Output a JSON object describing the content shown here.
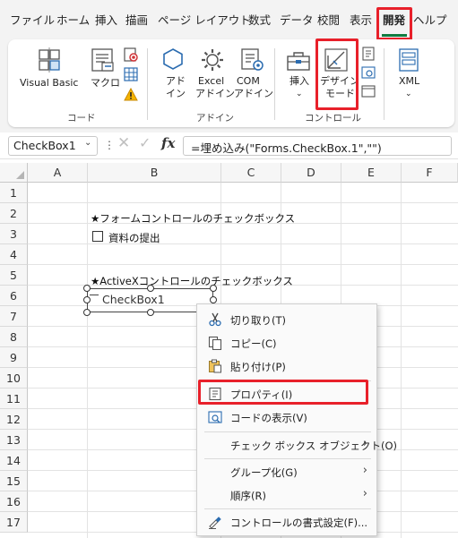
{
  "tabs": [
    {
      "label": "ファイル"
    },
    {
      "label": "ホーム"
    },
    {
      "label": "挿入"
    },
    {
      "label": "描画"
    },
    {
      "label": "ページ レイアウト"
    },
    {
      "label": "数式"
    },
    {
      "label": "データ"
    },
    {
      "label": "校閲"
    },
    {
      "label": "表示"
    },
    {
      "label": "開発"
    },
    {
      "label": "ヘルプ"
    }
  ],
  "ribbon": {
    "code_group": {
      "label": "コード",
      "visual_basic": "Visual Basic",
      "macro": "マクロ"
    },
    "addin_group": {
      "label": "アドイン",
      "addin_line1": "アド",
      "addin_line2": "イン",
      "excel_addin_line1": "Excel",
      "excel_addin_line2": "アドイン",
      "com_addin_line1": "COM",
      "com_addin_line2": "アドイン"
    },
    "controls_group": {
      "label": "コントロール",
      "insert": "挿入",
      "design_mode_line1": "デザイン",
      "design_mode_line2": "モード"
    },
    "xml": "XML"
  },
  "formula_bar": {
    "name_box": "CheckBox1",
    "formula": "=埋め込み(\"Forms.CheckBox.1\",\"\")"
  },
  "sheet": {
    "columns": [
      "A",
      "B",
      "C",
      "D",
      "E",
      "F"
    ],
    "rows": [
      "1",
      "2",
      "3",
      "4",
      "5",
      "6",
      "7",
      "8",
      "9",
      "10",
      "11",
      "12",
      "13",
      "14",
      "15",
      "16",
      "17"
    ],
    "b2": "★フォームコントロールのチェックボックス",
    "b3_checkbox_label": "資料の提出",
    "b5": "★ActiveXコントロールのチェックボックス",
    "activex_caption": "CheckBox1"
  },
  "context_menu": {
    "items": [
      {
        "label": "切り取り(T)"
      },
      {
        "label": "コピー(C)"
      },
      {
        "label": "貼り付け(P)"
      },
      {
        "label": "プロパティ(I)"
      },
      {
        "label": "コードの表示(V)"
      },
      {
        "label": "チェック ボックス オブジェクト(O)"
      },
      {
        "label": "グループ化(G)"
      },
      {
        "label": "順序(R)"
      },
      {
        "label": "コントロールの書式設定(F)..."
      }
    ]
  },
  "colors": {
    "highlight": "#e8202a",
    "excel_green": "#107c41"
  }
}
